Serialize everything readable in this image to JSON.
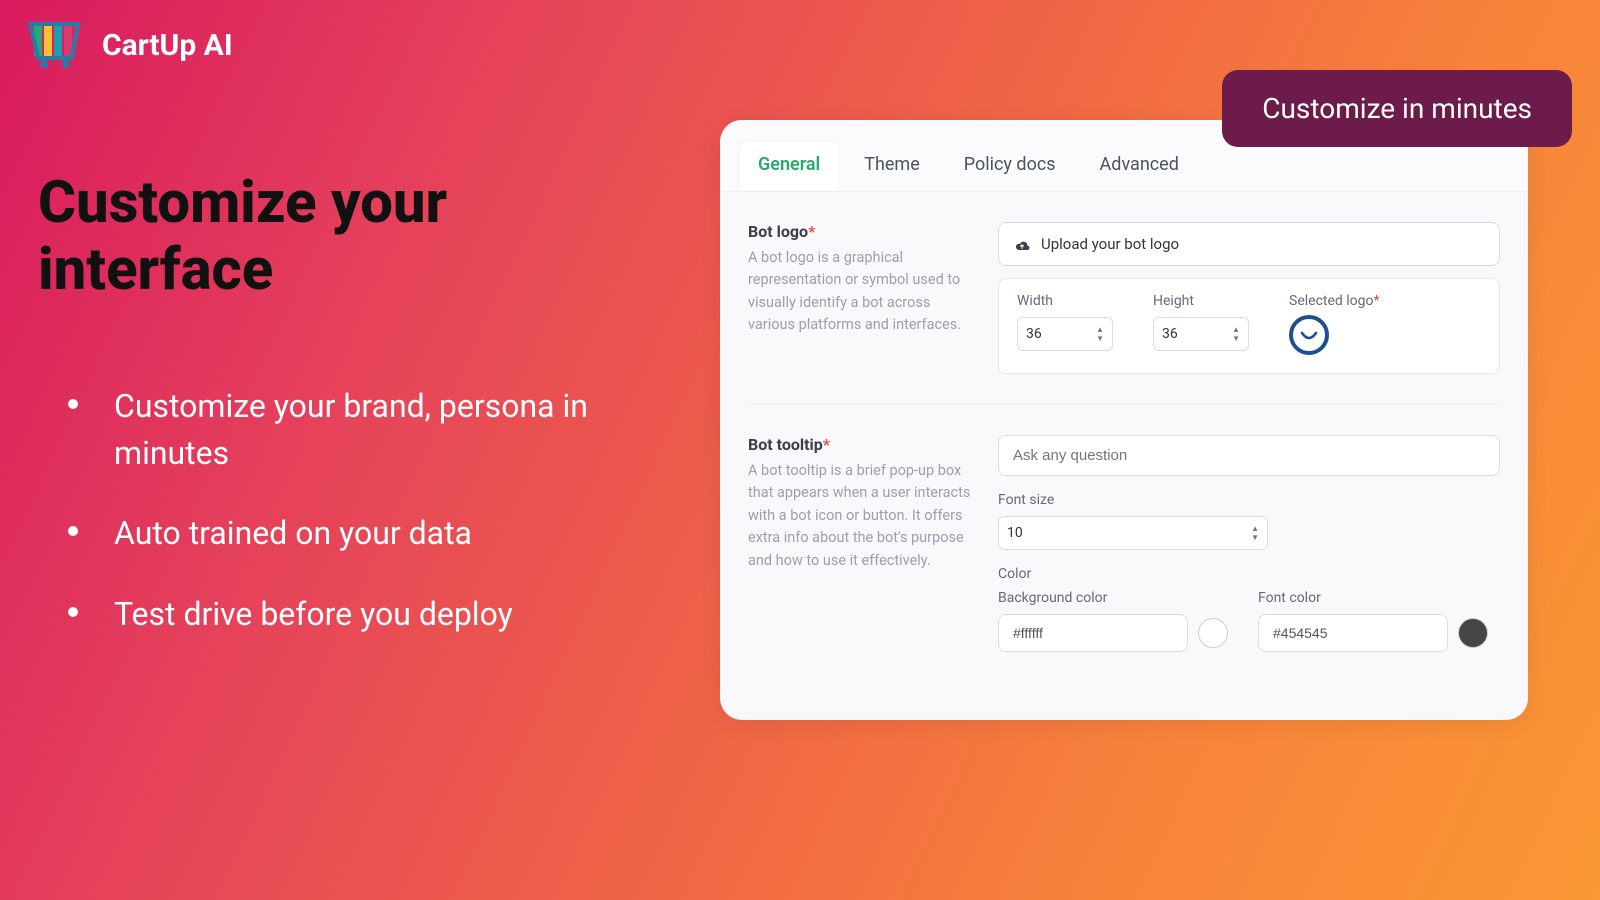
{
  "brand": "CartUp AI",
  "title": "Customize your interface",
  "bullets": [
    "Customize your brand, persona in minutes",
    "Auto trained on your data",
    "Test drive before you deploy"
  ],
  "callout": "Customize in minutes",
  "tabs": {
    "general": "General",
    "theme": "Theme",
    "policy": "Policy docs",
    "advanced": "Advanced"
  },
  "botlogo": {
    "title": "Bot logo",
    "desc": "A bot logo is a graphical representation or symbol used to visually identify a bot across various platforms and interfaces.",
    "upload_label": "Upload your bot logo",
    "width_label": "Width",
    "width_value": "36",
    "height_label": "Height",
    "height_value": "36",
    "selected_label": "Selected logo"
  },
  "tooltip": {
    "title": "Bot tooltip",
    "desc": "A bot tooltip is a brief pop-up box that appears when a user interacts with a bot icon or button. It offers extra info about the bot's purpose and how to use it effectively.",
    "placeholder": "Ask any question",
    "fontsize_label": "Font size",
    "fontsize_value": "10",
    "color_label": "Color",
    "bg_label": "Background color",
    "bg_value": "#ffffff",
    "font_label": "Font color",
    "font_value": "#454545"
  },
  "colors": {
    "bg_swatch": "#ffffff",
    "font_swatch": "#454545"
  }
}
